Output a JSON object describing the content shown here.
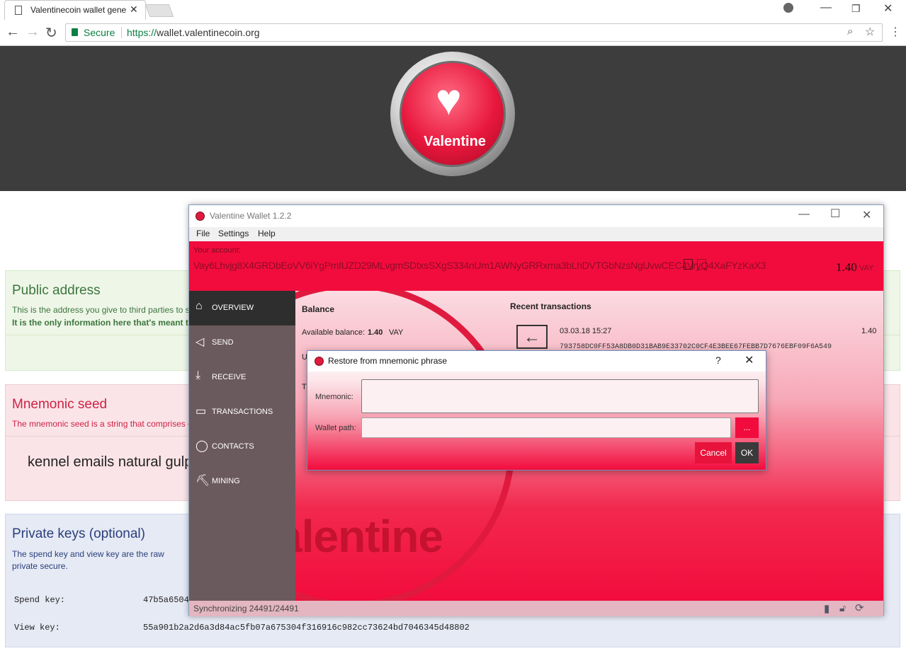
{
  "browser": {
    "tab_title": "Valentinecoin wallet gene",
    "secure_label": "Secure",
    "url_scheme": "https://",
    "url_host": "wallet.valentinecoin.org"
  },
  "site": {
    "logo_text": "Valentine",
    "public_address": {
      "title": "Public address",
      "desc": "This is the address you give to third parties to s",
      "desc_bold": "It is the only information here that's meant t"
    },
    "mnemonic_seed": {
      "title": "Mnemonic seed",
      "desc": "The mnemonic seed is a string that comprises c",
      "words": "kennel emails natural gulp"
    },
    "private_keys": {
      "title": "Private keys (optional)",
      "desc": "The spend key and view key are the raw private secure.",
      "spend_label": "Spend key:",
      "spend_value": "47b5a6504",
      "view_label": "View key:",
      "view_value": "55a901b2a2d6a3d84ac5fb07a675304f316916c982cc73624bd7046345d48802"
    }
  },
  "wallet": {
    "title": "Valentine Wallet 1.2.2",
    "menu": [
      "File",
      "Settings",
      "Help"
    ],
    "account_label": "Your account:",
    "address": "Vay6Lhvjg8X4GRDbEoVV6iYgPmIUZD29MLvgmSDtxsSXgS334nUm1AWNyGRRxma3bLhDVTGbNzsNgUvwCEC4VryQ4XaFYzKaX3",
    "balance": "1.40",
    "currency": "VAY",
    "nav": [
      "OVERVIEW",
      "SEND",
      "RECEIVE",
      "TRANSACTIONS",
      "CONTACTS",
      "MINING"
    ],
    "overview": {
      "balance_heading": "Balance",
      "available_label": "Available balance:",
      "available_value": "1.40",
      "available_currency": "VAY",
      "partial_u": "U",
      "partial_t": "T",
      "recent_heading": "Recent transactions",
      "tx_date": "03.03.18 15:27",
      "tx_amount": "1.40",
      "tx_hash": "793758DC0FF53A8DB0D31BAB9E33702C0CF4E3BEE67FEBB7D7676EBF09F6A549",
      "watermark": "Valentine"
    },
    "status": "Synchronizing 24491/24491"
  },
  "dialog": {
    "title": "Restore from mnemonic phrase",
    "help": "?",
    "mnemonic_label": "Mnemonic:",
    "mnemonic_value": "",
    "path_label": "Wallet path:",
    "path_value": "",
    "browse_label": "...",
    "cancel_label": "Cancel",
    "ok_label": "OK"
  }
}
